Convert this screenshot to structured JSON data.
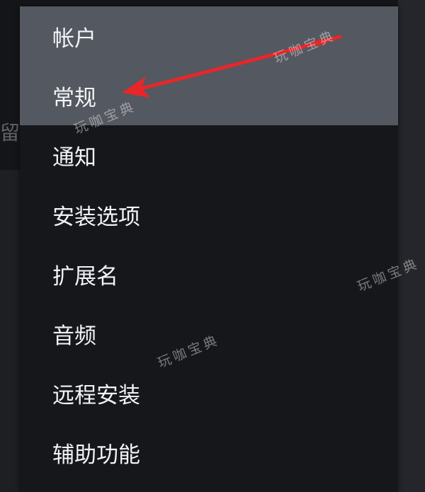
{
  "background": {
    "fragment_text": "留客"
  },
  "menu": {
    "items": [
      {
        "label": "帐户",
        "highlighted": true
      },
      {
        "label": "常规",
        "highlighted": true
      },
      {
        "label": "通知",
        "highlighted": false
      },
      {
        "label": "安装选项",
        "highlighted": false
      },
      {
        "label": "扩展名",
        "highlighted": false
      },
      {
        "label": "音频",
        "highlighted": false
      },
      {
        "label": "远程安装",
        "highlighted": false
      },
      {
        "label": "辅助功能",
        "highlighted": false
      }
    ]
  },
  "annotation": {
    "arrow_color": "#e8262a",
    "arrow_target": "常规"
  },
  "watermark": {
    "text": "玩咖宝典"
  },
  "colors": {
    "menu_bg": "#16171b",
    "highlight_bg": "#545860",
    "text": "#f2f3f5"
  }
}
